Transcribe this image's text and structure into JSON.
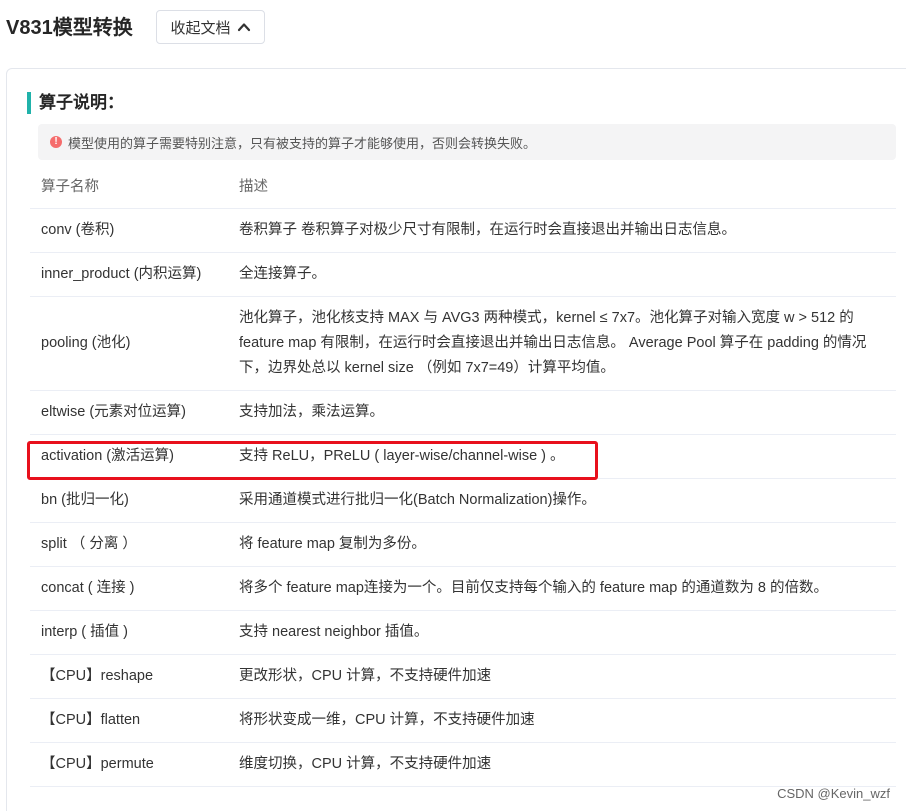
{
  "header": {
    "title": "V831模型转换",
    "collapse_label": "收起文档"
  },
  "section": {
    "title": "算子说明："
  },
  "notice": {
    "text": "模型使用的算子需要特别注意，只有被支持的算子才能够使用，否则会转换失败。"
  },
  "table": {
    "columns": [
      "算子名称",
      "描述"
    ],
    "rows": [
      {
        "name": "conv (卷积)",
        "desc": "卷积算子 卷积算子对极少尺寸有限制，在运行时会直接退出并输出日志信息。"
      },
      {
        "name": "inner_product (内积运算)",
        "desc": "全连接算子。"
      },
      {
        "name": "pooling (池化)",
        "desc": "池化算子，池化核支持 MAX 与 AVG3 两种模式，kernel ≤ 7x7。池化算子对输入宽度 w > 512 的 feature map 有限制，在运行时会直接退出并输出日志信息。 Average Pool 算子在 padding 的情况下，边界处总以 kernel size （例如 7x7=49）计算平均值。"
      },
      {
        "name": "eltwise (元素对位运算)",
        "desc": "支持加法，乘法运算。"
      },
      {
        "name": "activation (激活运算)",
        "desc": "支持 ReLU，PReLU ( layer-wise/channel-wise ) 。"
      },
      {
        "name": "bn (批归一化)",
        "desc": "采用通道模式进行批归一化(Batch Normalization)操作。"
      },
      {
        "name": "split （ 分离 ）",
        "desc": "将 feature map 复制为多份。"
      },
      {
        "name": "concat ( 连接 )",
        "desc": "将多个 feature map连接为一个。目前仅支持每个输入的 feature map 的通道数为 8 的倍数。"
      },
      {
        "name": "interp ( 插值 )",
        "desc": "支持 nearest neighbor 插值。"
      },
      {
        "name": "【CPU】reshape",
        "desc": "更改形状，CPU 计算，不支持硬件加速"
      },
      {
        "name": "【CPU】flatten",
        "desc": "将形状变成一维，CPU 计算，不支持硬件加速"
      },
      {
        "name": "【CPU】permute",
        "desc": "维度切换，CPU 计算，不支持硬件加速"
      }
    ]
  },
  "watermark": "CSDN @Kevin_wzf",
  "colors": {
    "accent": "#20b2aa",
    "highlight": "#e8101c",
    "warning": "#f56c6c"
  }
}
